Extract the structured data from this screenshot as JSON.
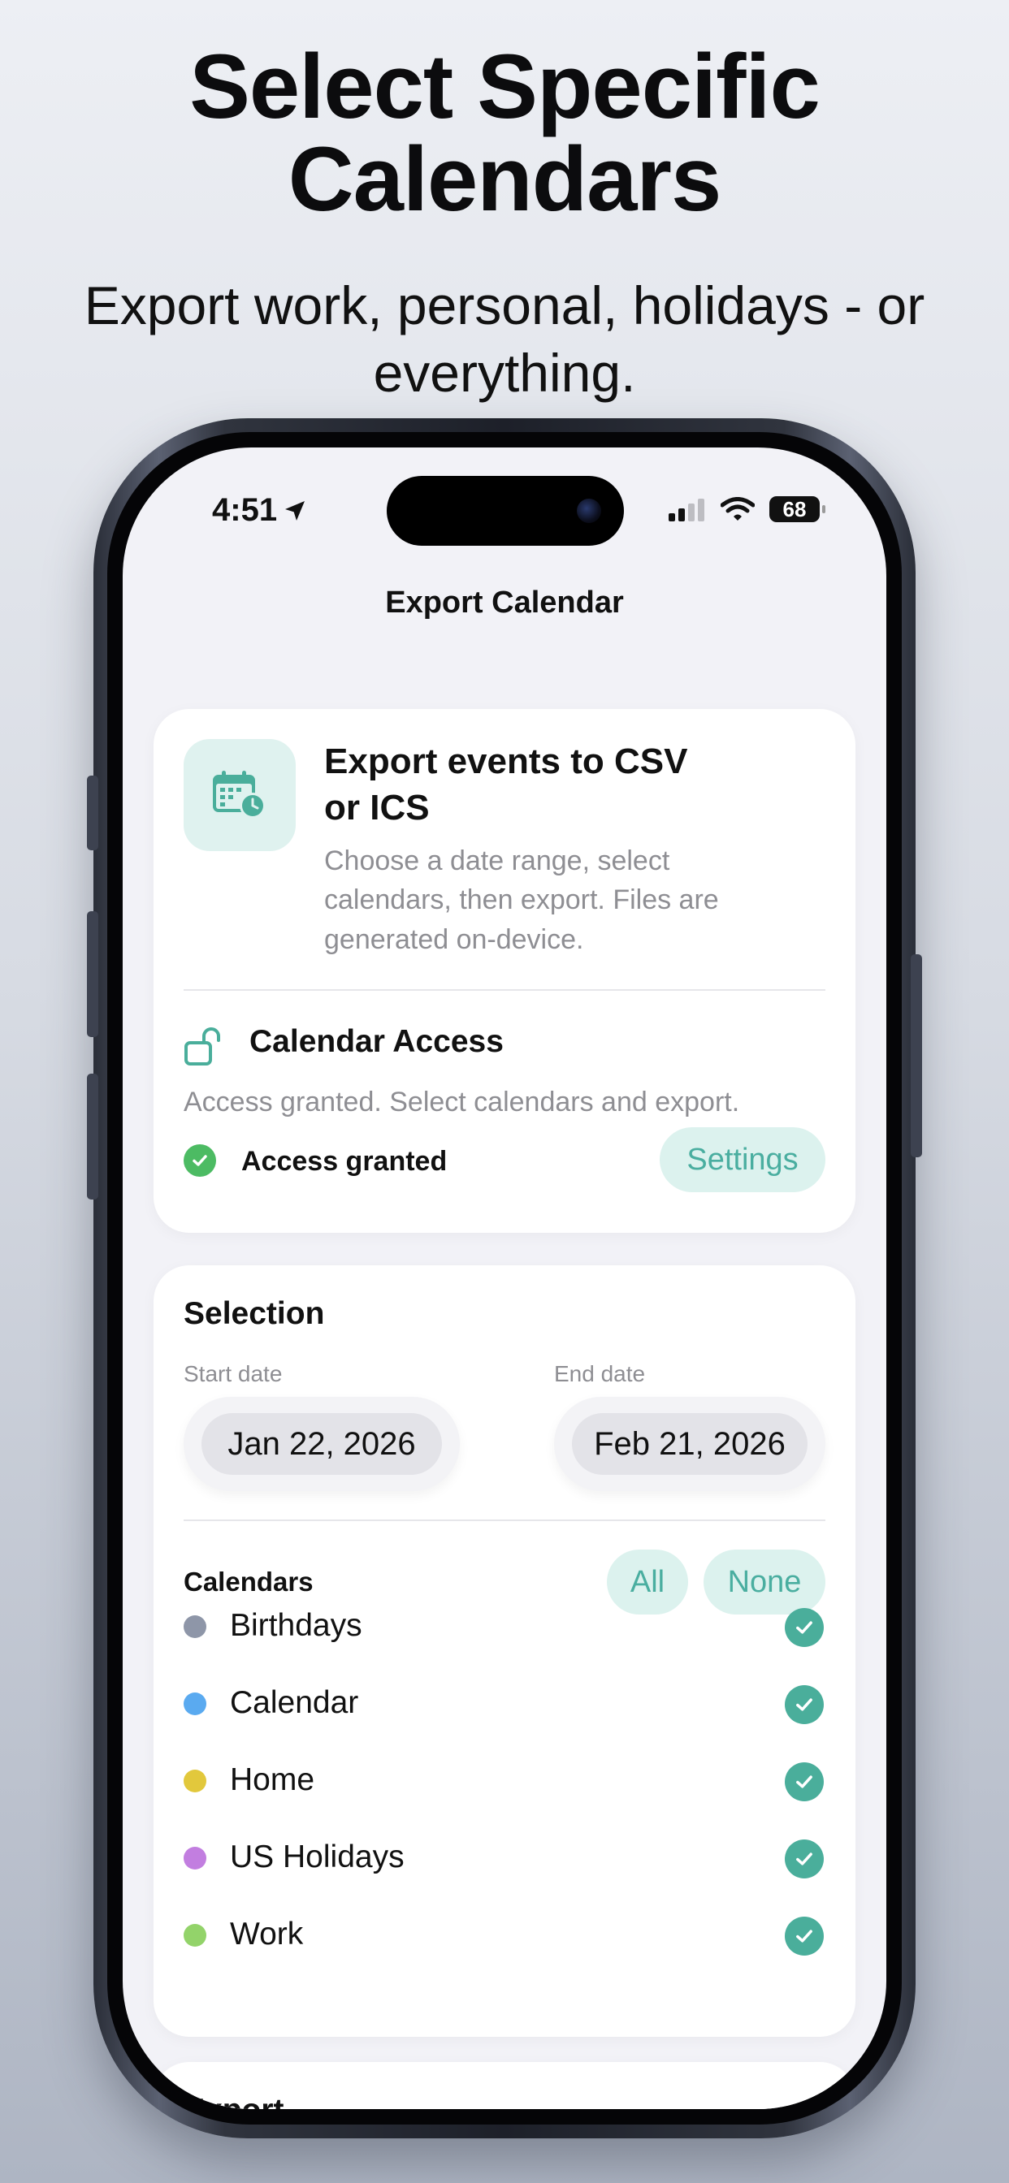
{
  "header": {
    "headline_line1": "Select Specific",
    "headline_line2": "Calendars",
    "sub_line1": "Export work, personal, holidays - or",
    "sub_line2": "everything."
  },
  "status_bar": {
    "time": "4:51",
    "battery": "68",
    "location_icon": "location-arrow-icon",
    "signal_icon": "cellular-signal-icon",
    "wifi_icon": "wifi-icon"
  },
  "nav": {
    "title": "Export Calendar"
  },
  "hero": {
    "icon": "calendar-clock-icon",
    "title_line1": "Export events to CSV",
    "title_line2": "or ICS",
    "desc_line1": "Choose a date range, select",
    "desc_line2": "calendars, then export. Files are",
    "desc_line3": "generated on-device."
  },
  "access": {
    "icon": "unlock-icon",
    "title": "Calendar Access",
    "description": "Access granted. Select calendars and export.",
    "status_label": "Access granted",
    "settings_label": "Settings"
  },
  "selection": {
    "title": "Selection",
    "start_label": "Start date",
    "start_value": "Jan 22, 2026",
    "end_label": "End date",
    "end_value": "Feb 21, 2026",
    "calendars_label": "Calendars",
    "all_label": "All",
    "none_label": "None",
    "calendars": [
      {
        "name": "Birthdays",
        "color": "#8e96a8",
        "checked": true
      },
      {
        "name": "Calendar",
        "color": "#5aaaf0",
        "checked": true
      },
      {
        "name": "Home",
        "color": "#e2c83c",
        "checked": true
      },
      {
        "name": "US Holidays",
        "color": "#c27ee0",
        "checked": true
      },
      {
        "name": "Work",
        "color": "#93d36a",
        "checked": true
      }
    ]
  },
  "export": {
    "title": "Export"
  },
  "colors": {
    "accent": "#4aae9b",
    "accent_soft": "#dcf2ee",
    "granted_green": "#4cbb63"
  }
}
